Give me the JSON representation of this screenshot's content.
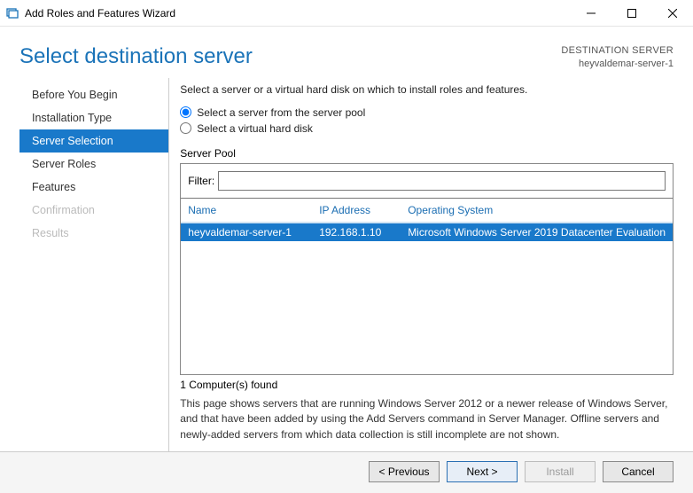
{
  "window": {
    "title": "Add Roles and Features Wizard"
  },
  "header": {
    "page_title": "Select destination server",
    "destination_label": "DESTINATION SERVER",
    "destination_value": "heyvaldemar-server-1"
  },
  "sidebar": {
    "items": [
      {
        "label": "Before You Begin",
        "state": "normal"
      },
      {
        "label": "Installation Type",
        "state": "normal"
      },
      {
        "label": "Server Selection",
        "state": "selected"
      },
      {
        "label": "Server Roles",
        "state": "normal"
      },
      {
        "label": "Features",
        "state": "normal"
      },
      {
        "label": "Confirmation",
        "state": "disabled"
      },
      {
        "label": "Results",
        "state": "disabled"
      }
    ]
  },
  "main": {
    "instruction": "Select a server or a virtual hard disk on which to install roles and features.",
    "radio1": "Select a server from the server pool",
    "radio2": "Select a virtual hard disk",
    "pool_label": "Server Pool",
    "filter_label": "Filter:",
    "filter_value": "",
    "columns": {
      "name": "Name",
      "ip": "IP Address",
      "os": "Operating System"
    },
    "rows": [
      {
        "name": "heyvaldemar-server-1",
        "ip": "192.168.1.10",
        "os": "Microsoft Windows Server 2019 Datacenter Evaluation"
      }
    ],
    "found_text": "1 Computer(s) found",
    "description": "This page shows servers that are running Windows Server 2012 or a newer release of Windows Server, and that have been added by using the Add Servers command in Server Manager. Offline servers and newly-added servers from which data collection is still incomplete are not shown."
  },
  "footer": {
    "previous": "< Previous",
    "next": "Next >",
    "install": "Install",
    "cancel": "Cancel"
  }
}
